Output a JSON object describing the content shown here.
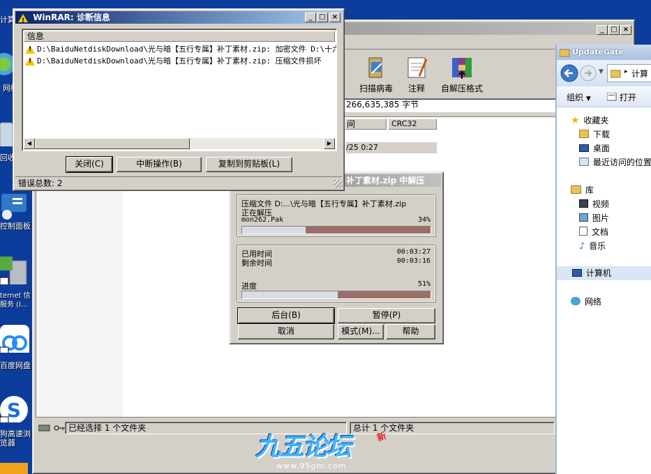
{
  "desktop": {
    "icons": [
      {
        "id": "computer",
        "label": "计算"
      },
      {
        "id": "network",
        "label": "网络"
      },
      {
        "id": "recycle",
        "label": "回收"
      },
      {
        "id": "control-panel",
        "label": "控制面板"
      },
      {
        "id": "iis",
        "label": "ternet 信\n服务 (I..."
      },
      {
        "id": "baidu-netdisk",
        "label": "百度网盘"
      },
      {
        "id": "sogou-browser",
        "label": "狗高速浏\n览器"
      }
    ],
    "watermark_text": "九五论坛",
    "watermark_url": "www.95gm.com",
    "watermark_badge": "新"
  },
  "winrar_main": {
    "toolbar": [
      {
        "id": "scan",
        "label": "扫描病毒",
        "icon": "scan-virus-icon"
      },
      {
        "id": "comment",
        "label": "注释",
        "icon": "comment-icon"
      },
      {
        "id": "sfx",
        "label": "自解压格式",
        "icon": "sfx-icon"
      }
    ],
    "info_text": "266,635,385 字节",
    "columns": [
      "间",
      "CRC32"
    ],
    "row_date": "/25 0:27",
    "status_left": "已经选择 1 个文件夹",
    "status_right": "总计 1 个文件夹"
  },
  "diag": {
    "title": "WinRAR: 诊断信息",
    "list_header": "信息",
    "messages": [
      "D:\\BaiduNetdiskDownload\\光与暗【五行专属】补丁素材.zip: 加密文件 D:\\十六",
      "D:\\BaiduNetdiskDownload\\光与暗【五行专属】补丁素材.zip: 压缩文件损坏"
    ],
    "buttons": {
      "close": "关闭(C)",
      "abort": "中断操作(B)",
      "copy": "复制到剪贴板(L)"
    },
    "error_count": "错误总数: 2"
  },
  "extract": {
    "title": "补丁素材.zip 中解压",
    "archive_line": "压缩文件 D:...\\光与暗【五行专属】补丁素材.zip",
    "action": "正在解压",
    "current_file": "mon262.Pak",
    "file_progress": 34,
    "file_percent": "34%",
    "elapsed_label": "已用时间",
    "elapsed": "00:03:27",
    "remaining_label": "剩余时间",
    "remaining": "00:03:16",
    "progress_label": "进度",
    "total_progress": 51,
    "total_percent": "51%",
    "buttons": {
      "background": "后台(B)",
      "pause": "暂停(P)",
      "cancel": "取消",
      "mode": "模式(M)...",
      "help": "帮助"
    }
  },
  "explorer": {
    "title": "UpdateGate",
    "path_crumb": "计算",
    "toolbar": {
      "organize": "组织",
      "open": "打开"
    },
    "favorites_header": "收藏夹",
    "favorites": [
      "下载",
      "桌面",
      "最近访问的位置"
    ],
    "libraries_header": "库",
    "libraries": [
      "视频",
      "图片",
      "文档",
      "音乐"
    ],
    "computer": "计算机",
    "network": "网络"
  }
}
